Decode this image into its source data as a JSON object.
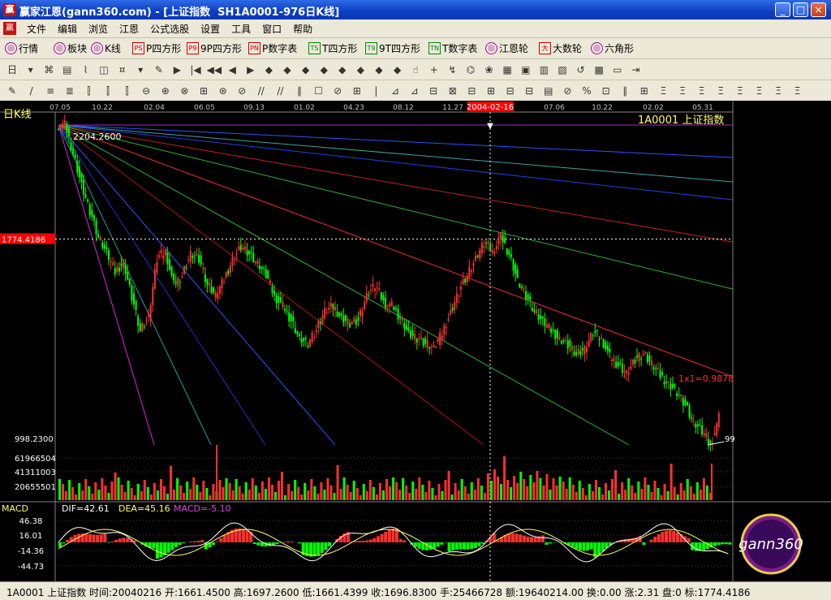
{
  "window": {
    "title": "赢家江恩(gann360.com) - [上证指数  SH1A0001-976日K线]",
    "buttons": {
      "minimize": "_",
      "maximize": "□",
      "close": "×"
    }
  },
  "menu": [
    "文件",
    "编辑",
    "浏览",
    "江恩",
    "公式选股",
    "设置",
    "工具",
    "窗口",
    "帮助"
  ],
  "toolbar1": [
    {
      "icon": "grid-icon",
      "label": "行情"
    },
    {
      "icon": "blocks-icon",
      "label": "板块"
    },
    {
      "icon": "kline-icon",
      "label": "K线"
    },
    {
      "icon": "ps-icon",
      "glyph": "PS",
      "label": "P四方形"
    },
    {
      "icon": "p9-icon",
      "glyph": "P9",
      "label": "9P四方形"
    },
    {
      "icon": "pn-icon",
      "glyph": "PN",
      "label": "P数字表"
    },
    {
      "icon": "ts-icon",
      "glyph": "TS",
      "label": "T四方形"
    },
    {
      "icon": "t9-icon",
      "glyph": "T9",
      "label": "9T四方形"
    },
    {
      "icon": "tn-icon",
      "glyph": "TN",
      "label": "T数字表"
    },
    {
      "icon": "gann-wheel-icon",
      "label": "江恩轮"
    },
    {
      "icon": "big-wheel-icon",
      "glyph": "大",
      "label": "大数轮"
    },
    {
      "icon": "hexagon-icon",
      "label": "六角形"
    }
  ],
  "chart_data": {
    "type": "candlestick",
    "title": "1A0001 上证指数",
    "panel_label": "日K线",
    "date_ticks": [
      "07.05",
      "10.22",
      "02.04",
      "06.05",
      "09.13",
      "01.02",
      "04.23",
      "08.12",
      "11.27",
      "2004-02-16",
      "07.06",
      "10.22",
      "02.02",
      "05.31"
    ],
    "cursor_date": "2004-02-16",
    "price_labels": {
      "high": "2204.2600",
      "low": "998.2300",
      "cursor": "1774.4186",
      "low_right": "99"
    },
    "gann_annotation": "1x1=0.9878",
    "volume_ticks": [
      "61966504",
      "41311003",
      "20655501"
    ],
    "macd": {
      "label": "MACD",
      "dif": "DIF=42.61",
      "dea": "DEA=45.16",
      "macd": "MACD=-5.10",
      "ticks": [
        "46.38",
        "16.01",
        "-14.36",
        "-44.73"
      ]
    },
    "series_close_approx": [
      2204,
      2100,
      1980,
      1880,
      1780,
      1720,
      1650,
      1690,
      1560,
      1430,
      1480,
      1700,
      1730,
      1600,
      1640,
      1720,
      1700,
      1600,
      1560,
      1620,
      1700,
      1750,
      1720,
      1680,
      1640,
      1560,
      1520,
      1470,
      1400,
      1380,
      1430,
      1500,
      1520,
      1480,
      1460,
      1470,
      1560,
      1600,
      1540,
      1520,
      1480,
      1420,
      1400,
      1380,
      1360,
      1420,
      1500,
      1580,
      1640,
      1700,
      1760,
      1730,
      1780,
      1720,
      1620,
      1560,
      1500,
      1460,
      1430,
      1400,
      1380,
      1340,
      1360,
      1420,
      1400,
      1330,
      1300,
      1270,
      1320,
      1340,
      1300,
      1260,
      1230,
      1200,
      1150,
      1080,
      1050,
      998,
      1100
    ]
  },
  "colors": {
    "up": "#ff3030",
    "down": "#00ff00",
    "accent": "#ffff66",
    "cursor": "#ff0000"
  },
  "status": {
    "text": "1A0001 上证指数 时间:20040216 开:1661.4500 高:1697.2600 低:1661.4399 收:1696.8300 手:25466728 额:19640214.00 换:0.00 涨:2.31 盘:0 标:1774.4186"
  },
  "watermark": {
    "text": "gann360",
    "digits": "1234567891011121314151617181920"
  }
}
